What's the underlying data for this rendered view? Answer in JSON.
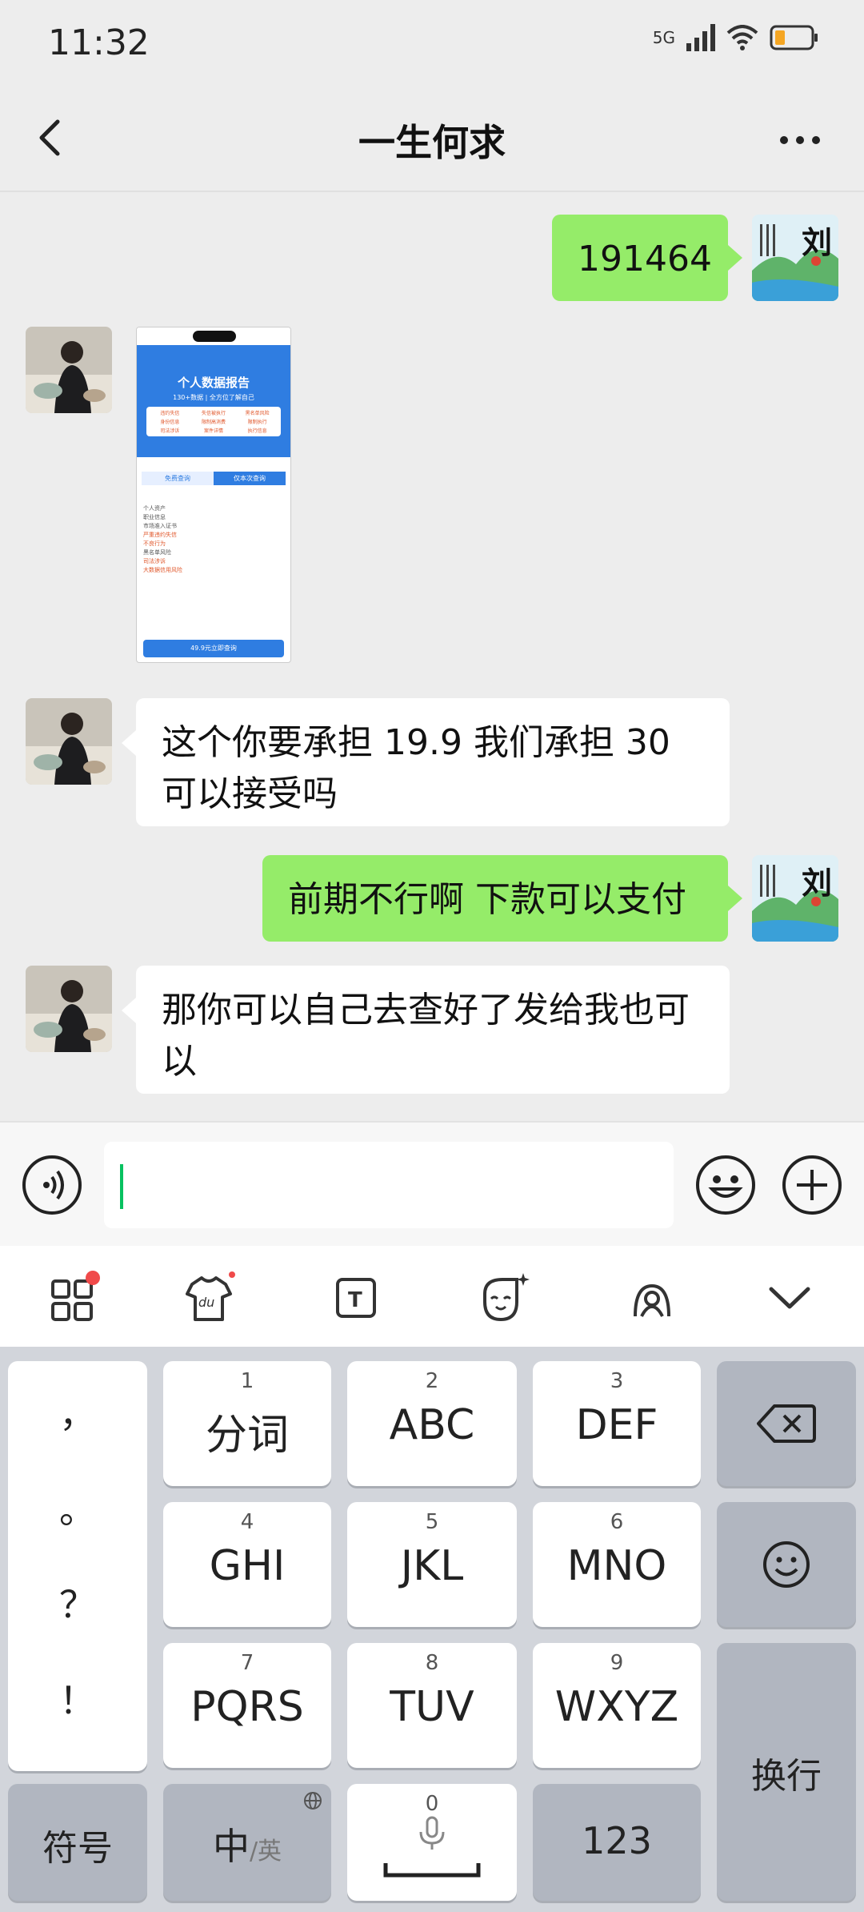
{
  "status_bar": {
    "time": "11:32",
    "network": "5G"
  },
  "nav": {
    "title": "一生何求"
  },
  "messages": [
    {
      "side": "me",
      "text": "191464"
    },
    {
      "side": "them",
      "type": "image",
      "screenshot": {
        "title": "个人数据报告",
        "subtitle": "130+数据 | 全方位了解自己",
        "tags": [
          "违约失信",
          "失信被执行",
          "黑名单风险",
          "身份信息",
          "限制高消费",
          "限制执行",
          "司法涉诉",
          "案件详情",
          "执行信息"
        ],
        "tab_free": "免费查询",
        "tab_query": "仅本次查询",
        "items": [
          "个人资产",
          "职业信息",
          "市场准入证书",
          "严重违约失信",
          "不良行为",
          "黑名单风险",
          "司法涉诉",
          "大数据信用风险"
        ],
        "button": "49.9元立即查询"
      }
    },
    {
      "side": "them",
      "text": "这个你要承担 19.9 我们承担 30 可以接受吗"
    },
    {
      "side": "me",
      "text": "前期不行啊 下款可以支付"
    },
    {
      "side": "them",
      "text": "那你可以自己去查好了发给我也可以"
    }
  ],
  "input": {
    "value": ""
  },
  "keyboard": {
    "punctuation": [
      "，",
      "。",
      "？",
      "！"
    ],
    "keys": [
      {
        "num": "1",
        "label": "分词"
      },
      {
        "num": "2",
        "label": "ABC"
      },
      {
        "num": "3",
        "label": "DEF"
      },
      {
        "num": "4",
        "label": "GHI"
      },
      {
        "num": "5",
        "label": "JKL"
      },
      {
        "num": "6",
        "label": "MNO"
      },
      {
        "num": "7",
        "label": "PQRS"
      },
      {
        "num": "8",
        "label": "TUV"
      },
      {
        "num": "9",
        "label": "WXYZ"
      }
    ],
    "symbols": "符号",
    "lang_main": "中",
    "lang_alt": "/英",
    "space_num": "0",
    "numbers": "123",
    "enter": "换行"
  },
  "colors": {
    "me_bubble": "#95ec69",
    "them_bubble": "#ffffff",
    "cursor": "#07c160",
    "badge": "#f04a4a"
  }
}
